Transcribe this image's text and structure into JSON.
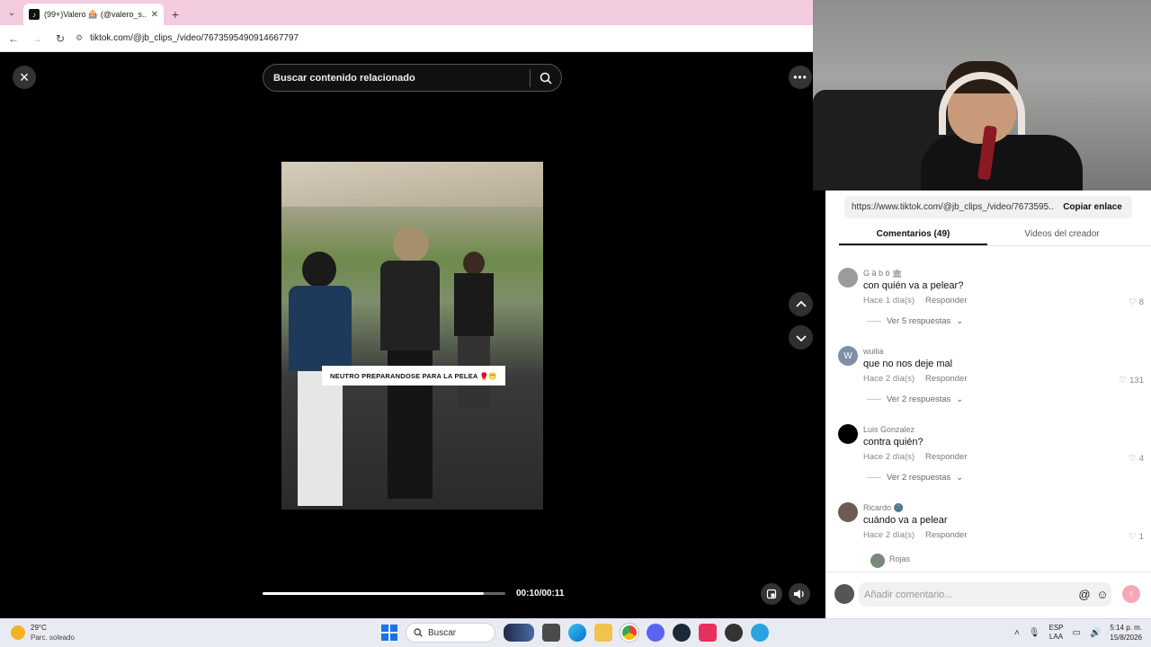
{
  "browser": {
    "tab_title": "(99+)Valero 🎰 (@valero_s...",
    "url": "tiktok.com/@jb_clips_/video/7673595490914667797"
  },
  "video": {
    "search_placeholder": "Buscar contenido relacionado",
    "caption": "NEUTRO PREPARANDOSE PARA LA PELEA 🥊😬",
    "time": "00:10/00:11",
    "progress": 0.91
  },
  "panel": {
    "share_url": "https://www.tiktok.com/@jb_clips_/video/7673595...",
    "copy_label": "Copiar enlace",
    "tabs": [
      "Comentarios (49)",
      "Videos del creador"
    ],
    "reply_label": "Responder",
    "comments": [
      {
        "user": "G ä b ö 🏛",
        "text": "con quién va a pelear?",
        "time": "Hace 1 día(s)",
        "likes": "8",
        "replies": "Ver 5 respuestas",
        "avatar_color": "#9b9b9b"
      },
      {
        "user": "wuilia",
        "text": "que no nos deje mal",
        "time": "Hace 2 día(s)",
        "likes": "131",
        "replies": "Ver 2 respuestas",
        "avatar_color": "#7f8fa6"
      },
      {
        "user": "Luis Gonzalez",
        "text": "contra quién?",
        "time": "Hace 2 día(s)",
        "likes": "4",
        "replies": "Ver 2 respuestas",
        "avatar_color": "#000000"
      },
      {
        "user": "Ricardo 🌚",
        "text": "cuándo va a pelear",
        "time": "Hace 2 día(s)",
        "likes": "1",
        "replies": "",
        "avatar_color": "#6d5a55"
      }
    ],
    "sub_comment_user": "Rojas",
    "composer_placeholder": "Añadir comentario..."
  },
  "taskbar": {
    "temp": "29°C",
    "weather": "Parc. soleado",
    "search": "Buscar",
    "lang1": "ESP",
    "lang2": "LAA",
    "time": "5:14 p. m.",
    "date": "15/8/2026"
  },
  "colors": {
    "tab_bar": "#f4cce0",
    "send_button": "#f7a8b8",
    "start": "#1a73e8"
  }
}
